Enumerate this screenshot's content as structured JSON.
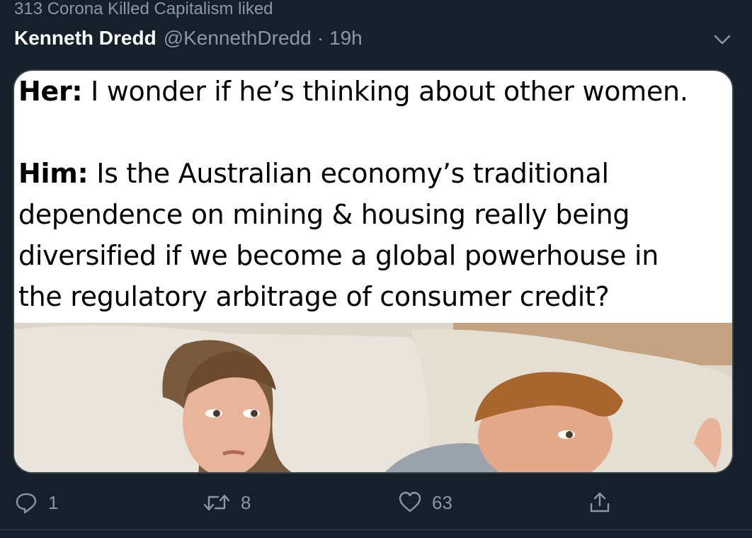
{
  "social_context": "313 Corona Killed Capitalism liked",
  "tweet": {
    "author_name": "Kenneth Dredd",
    "author_handle": "@KennethDredd",
    "separator": "·",
    "timestamp": "19h",
    "menu_icon": "chevron-down-icon",
    "media": {
      "line1_label": "Her:",
      "line1_text": " I wonder if he’s thinking about other women.",
      "line2_label": "Him:",
      "line2_text_1": " Is the Australian economy’s traditional",
      "line2_text_2": "dependence on mining & housing really being",
      "line2_text_3": "diversified if we become a global powerhouse in",
      "line2_text_4": "the regulatory arbitrage of consumer credit?"
    },
    "actions": {
      "reply_icon": "reply-icon",
      "reply_count": "1",
      "retweet_icon": "retweet-icon",
      "retweet_count": "8",
      "like_icon": "heart-icon",
      "like_count": "63",
      "share_icon": "share-icon"
    }
  },
  "colors": {
    "background": "#15202b",
    "secondary_text": "#8899a6",
    "border": "#38444d"
  }
}
